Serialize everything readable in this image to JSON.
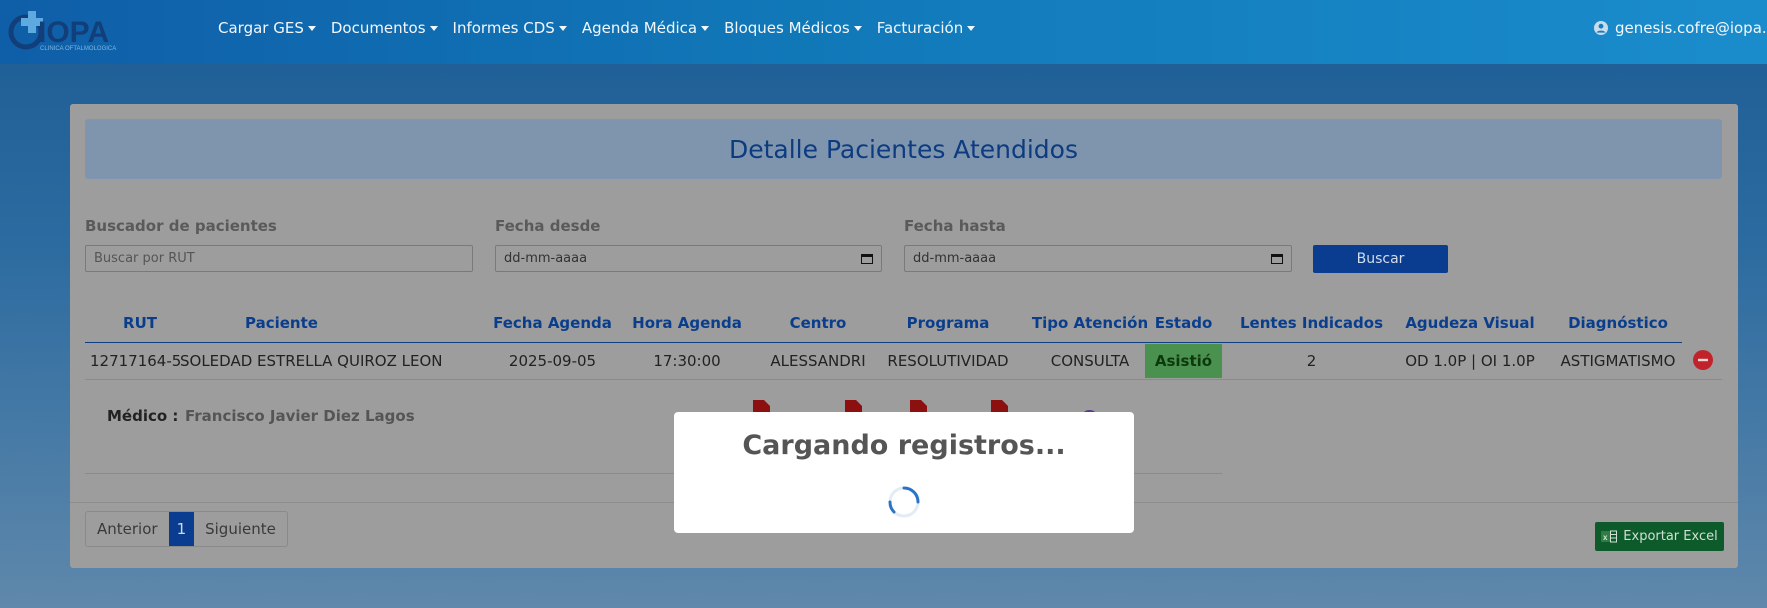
{
  "navbar": {
    "logo_text": "IOPA",
    "logo_subtext": "CLINICA OFTALMOLOGICA",
    "menu": [
      {
        "label": "Cargar GES"
      },
      {
        "label": "Documentos"
      },
      {
        "label": "Informes CDS"
      },
      {
        "label": "Agenda Médica"
      },
      {
        "label": "Bloques Médicos"
      },
      {
        "label": "Facturación"
      }
    ],
    "user_email": "genesis.cofre@iopa.c"
  },
  "page": {
    "title": "Detalle Pacientes Atendidos"
  },
  "filters": {
    "search_label": "Buscador de pacientes",
    "search_placeholder": "Buscar por RUT",
    "from_label": "Fecha desde",
    "from_value": "dd-mm-aaaa",
    "to_label": "Fecha hasta",
    "to_value": "dd-mm-aaaa",
    "search_button": "Buscar"
  },
  "table": {
    "columns": [
      "RUT",
      "Paciente",
      "Fecha Agenda",
      "Hora Agenda",
      "Centro",
      "Programa",
      "Tipo Atención",
      "Estado",
      "Lentes Indicados",
      "Agudeza Visual",
      "Diagnóstico"
    ],
    "rows": [
      {
        "rut": "12717164-5",
        "paciente": "SOLEDAD ESTRELLA QUIROZ LEON",
        "fecha": "2025-09-05",
        "hora": "17:30:00",
        "centro": "ALESSANDRI",
        "programa": "RESOLUTIVIDAD",
        "tipo": "CONSULTA",
        "estado": "Asistió",
        "lentes": "2",
        "agudeza": "OD 1.0P | OI 1.0P",
        "diagnostico": "ASTIGMATISMO"
      }
    ],
    "detail": {
      "medico_label": "Médico :",
      "medico_name": "Francisco Javier Diez Lagos"
    }
  },
  "pagination": {
    "prev": "Anterior",
    "current": "1",
    "next": "Siguiente"
  },
  "export_button": "Exportar Excel",
  "modal": {
    "title": "Cargando registros..."
  },
  "colors": {
    "brand_blue": "#0f5ea8",
    "primary": "#0a3d8f",
    "success": "#4a9150",
    "danger": "#c0242a",
    "excel_green": "#0d5a2a"
  }
}
